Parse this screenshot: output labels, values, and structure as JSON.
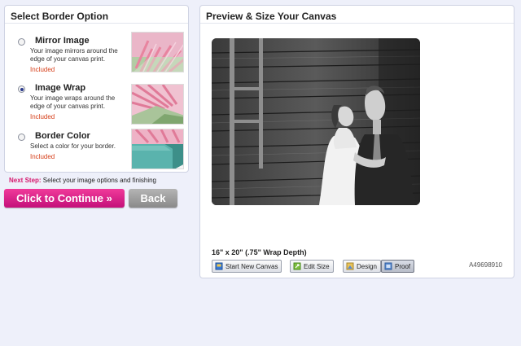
{
  "left_panel": {
    "title": "Select Border Option",
    "options": [
      {
        "title": "Mirror Image",
        "description": "Your image mirrors around the edge of your canvas print.",
        "included": "Included",
        "selected": false,
        "thumb": "pink-flower-mirror"
      },
      {
        "title": "Image Wrap",
        "description": "Your image wraps around the edge of your canvas print.",
        "included": "Included",
        "selected": true,
        "thumb": "pink-flower-wrap"
      },
      {
        "title": "Border Color",
        "description": "Select a color for your border.",
        "included": "Included",
        "selected": false,
        "thumb": "pink-flower-teal-border"
      }
    ]
  },
  "next_step": {
    "label": "Next Step:",
    "text": "Select your image options and finishing"
  },
  "buttons": {
    "continue": "Click to Continue »",
    "back": "Back"
  },
  "right_panel": {
    "title": "Preview & Size Your Canvas",
    "size_label": "16\" x 20\" (.75\" Wrap Depth)",
    "toolbar": {
      "start_new": "Start New Canvas",
      "edit_size": "Edit Size",
      "design": "Design",
      "proof": "Proof"
    },
    "order_id": "A49698910"
  },
  "colors": {
    "accent_pink": "#d61a6e",
    "included_red": "#d6401b",
    "back_gray": "#9a9a9a",
    "page_bg": "#eef0fa"
  }
}
